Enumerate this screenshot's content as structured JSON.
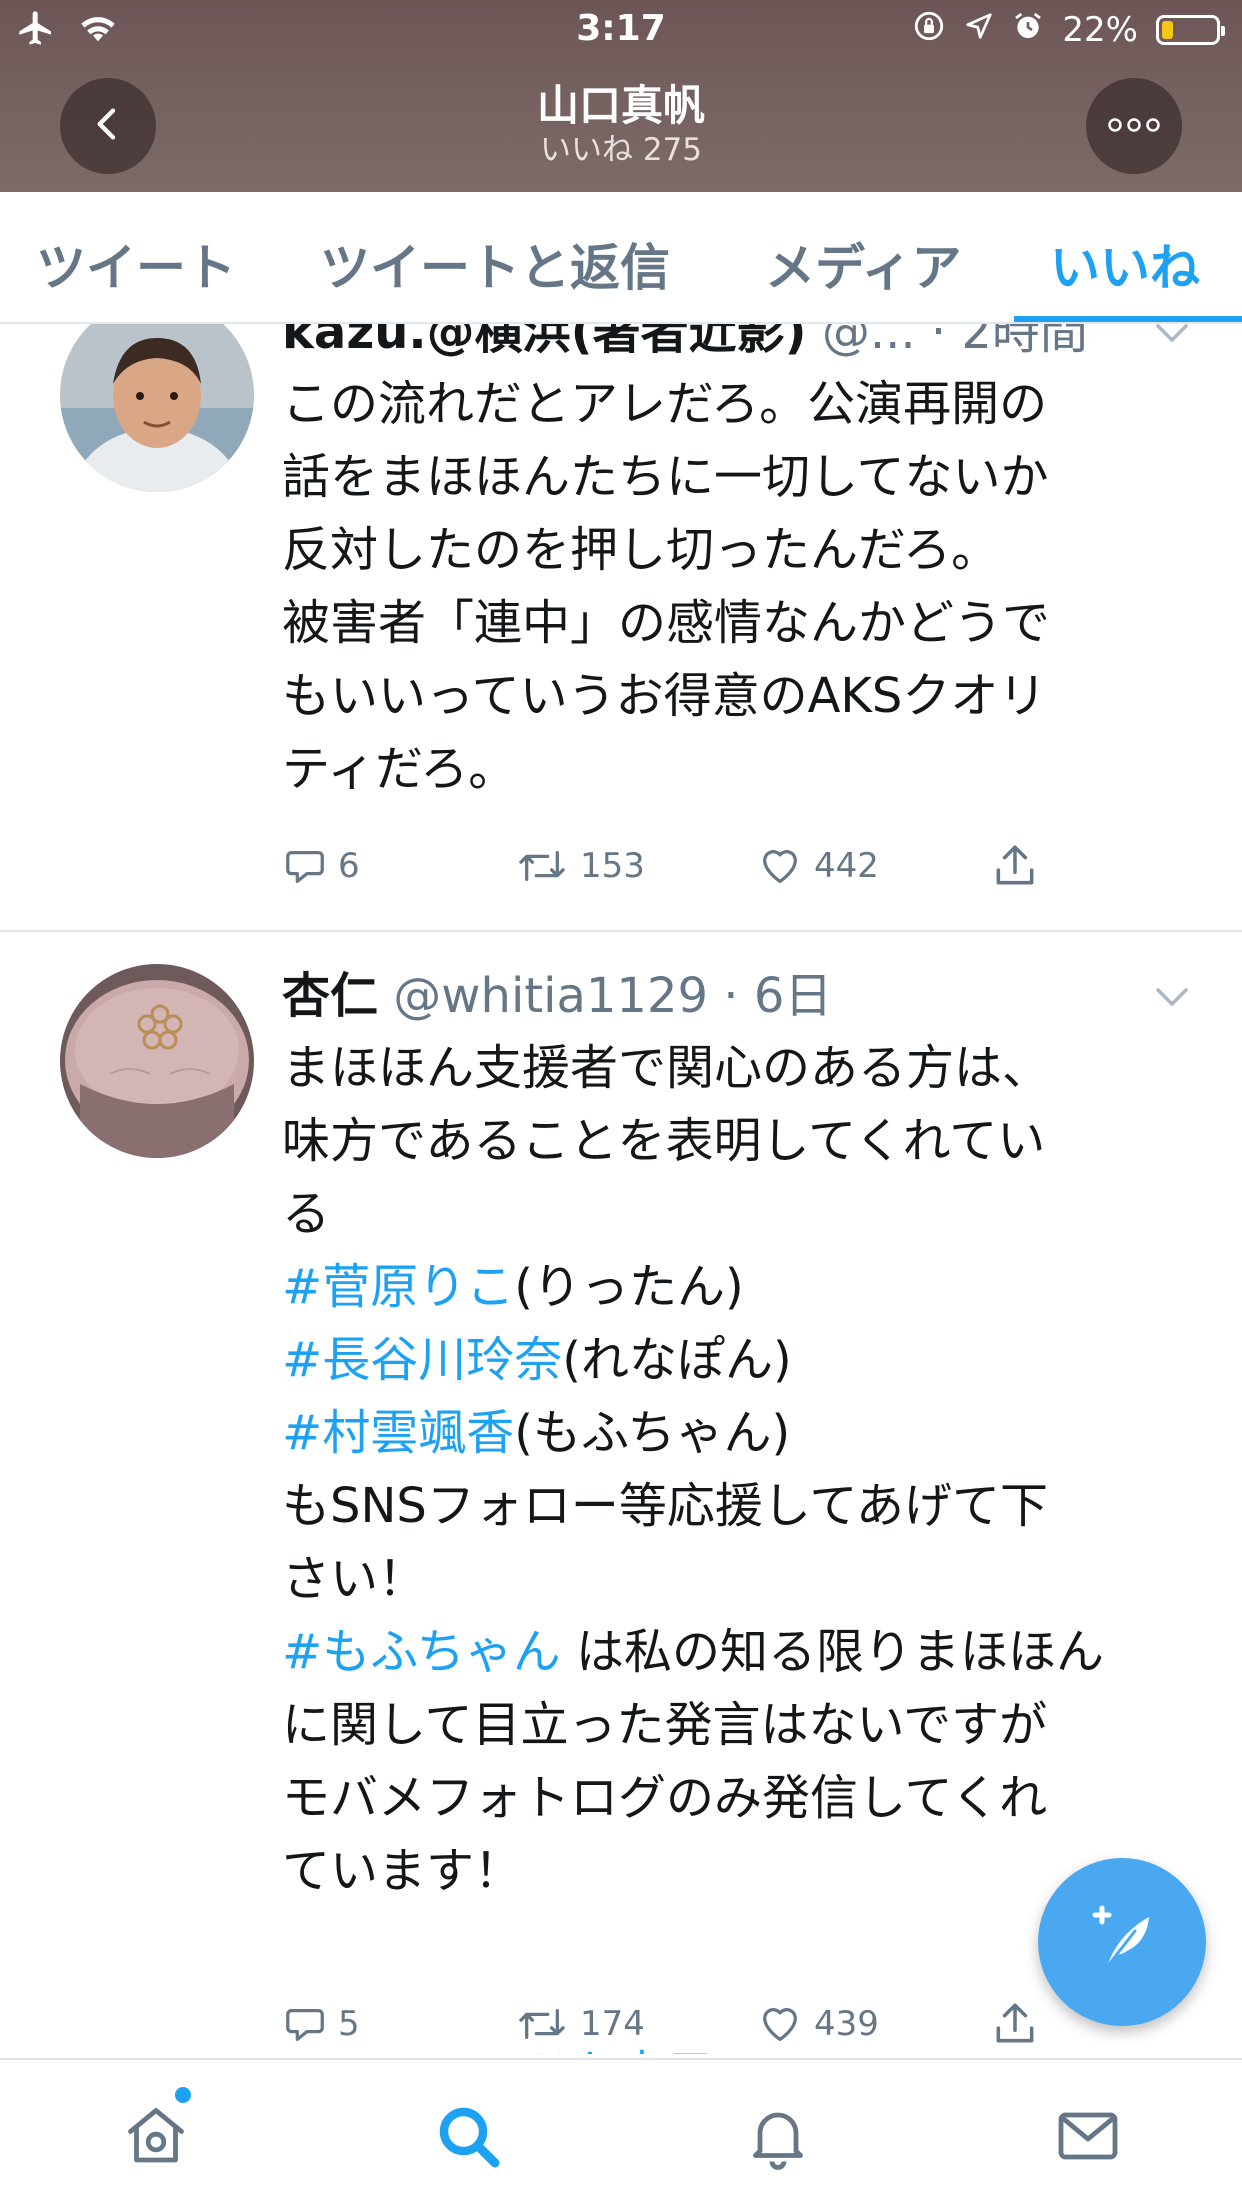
{
  "status_bar": {
    "time": "3:17",
    "battery": "22%",
    "battery_level": 0.22,
    "icons": [
      "airplane-icon",
      "wifi-icon",
      "orientation-lock-icon",
      "location-icon",
      "alarm-icon",
      "battery-icon"
    ]
  },
  "header": {
    "title": "山口真帆",
    "subtitle": "いいね 275",
    "back_icon": "chevron-left-icon",
    "more_icon": "more-icon"
  },
  "tabs": [
    {
      "label": "ツイート",
      "active": false
    },
    {
      "label": "ツイートと返信",
      "active": false
    },
    {
      "label": "メディア",
      "active": false
    },
    {
      "label": "いいね",
      "active": true
    }
  ],
  "tweets": [
    {
      "name": "kazu.@横浜(著者近影)",
      "handle": "@...",
      "time": "· 2時間",
      "lines": [
        "この流れだとアレだろ。公演再開の",
        "話をまほほんたちに一切してないか",
        "反対したのを押し切ったんだろ。",
        "被害者「連中」の感情なんかどうで",
        "もいいっていうお得意のAKSクオリ",
        "ティだろ。"
      ],
      "replies": "6",
      "retweets": "153",
      "likes": "442"
    },
    {
      "name": "杏仁",
      "handle": "@whitia1129",
      "time": "· 6日",
      "lines": [
        "まほほん支援者で関心のある方は、",
        "味方であることを表明してくれてい",
        "る"
      ],
      "tag_lines": [
        {
          "tag": "#菅原りこ",
          "rest": "(りったん)"
        },
        {
          "tag": "#長谷川玲奈",
          "rest": "(れなぽん)"
        },
        {
          "tag": "#村雲颯香",
          "rest": "(もふちゃん)"
        }
      ],
      "lines2": [
        "もSNSフォロー等応援してあげて下",
        "さい！"
      ],
      "tag_line2": {
        "tag": "#もふちゃん",
        "rest": " は私の知る限りまほほん"
      },
      "lines3": [
        "に関して目立った発言はないですが",
        "モバメフォトログのみ発信してくれ",
        "ています！"
      ],
      "replies": "5",
      "retweets": "174",
      "likes": "439",
      "show_thread": "このスレッドを表示"
    }
  ],
  "colors": {
    "accent": "#1da1f2",
    "secondary_text": "#657786",
    "header_bg": "#74605f",
    "fab": "#4aa8f0"
  },
  "bottom_nav": [
    "home-icon",
    "search-icon",
    "notifications-icon",
    "messages-icon"
  ],
  "fab_icon": "compose-icon"
}
